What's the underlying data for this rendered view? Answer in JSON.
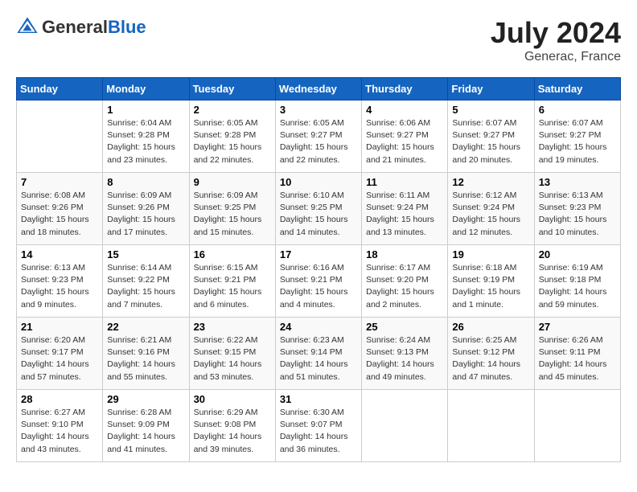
{
  "header": {
    "logo_general": "General",
    "logo_blue": "Blue",
    "month_year": "July 2024",
    "location": "Generac, France"
  },
  "weekdays": [
    "Sunday",
    "Monday",
    "Tuesday",
    "Wednesday",
    "Thursday",
    "Friday",
    "Saturday"
  ],
  "weeks": [
    [
      {
        "day": "",
        "info": ""
      },
      {
        "day": "1",
        "info": "Sunrise: 6:04 AM\nSunset: 9:28 PM\nDaylight: 15 hours\nand 23 minutes."
      },
      {
        "day": "2",
        "info": "Sunrise: 6:05 AM\nSunset: 9:28 PM\nDaylight: 15 hours\nand 22 minutes."
      },
      {
        "day": "3",
        "info": "Sunrise: 6:05 AM\nSunset: 9:27 PM\nDaylight: 15 hours\nand 22 minutes."
      },
      {
        "day": "4",
        "info": "Sunrise: 6:06 AM\nSunset: 9:27 PM\nDaylight: 15 hours\nand 21 minutes."
      },
      {
        "day": "5",
        "info": "Sunrise: 6:07 AM\nSunset: 9:27 PM\nDaylight: 15 hours\nand 20 minutes."
      },
      {
        "day": "6",
        "info": "Sunrise: 6:07 AM\nSunset: 9:27 PM\nDaylight: 15 hours\nand 19 minutes."
      }
    ],
    [
      {
        "day": "7",
        "info": "Sunrise: 6:08 AM\nSunset: 9:26 PM\nDaylight: 15 hours\nand 18 minutes."
      },
      {
        "day": "8",
        "info": "Sunrise: 6:09 AM\nSunset: 9:26 PM\nDaylight: 15 hours\nand 17 minutes."
      },
      {
        "day": "9",
        "info": "Sunrise: 6:09 AM\nSunset: 9:25 PM\nDaylight: 15 hours\nand 15 minutes."
      },
      {
        "day": "10",
        "info": "Sunrise: 6:10 AM\nSunset: 9:25 PM\nDaylight: 15 hours\nand 14 minutes."
      },
      {
        "day": "11",
        "info": "Sunrise: 6:11 AM\nSunset: 9:24 PM\nDaylight: 15 hours\nand 13 minutes."
      },
      {
        "day": "12",
        "info": "Sunrise: 6:12 AM\nSunset: 9:24 PM\nDaylight: 15 hours\nand 12 minutes."
      },
      {
        "day": "13",
        "info": "Sunrise: 6:13 AM\nSunset: 9:23 PM\nDaylight: 15 hours\nand 10 minutes."
      }
    ],
    [
      {
        "day": "14",
        "info": "Sunrise: 6:13 AM\nSunset: 9:23 PM\nDaylight: 15 hours\nand 9 minutes."
      },
      {
        "day": "15",
        "info": "Sunrise: 6:14 AM\nSunset: 9:22 PM\nDaylight: 15 hours\nand 7 minutes."
      },
      {
        "day": "16",
        "info": "Sunrise: 6:15 AM\nSunset: 9:21 PM\nDaylight: 15 hours\nand 6 minutes."
      },
      {
        "day": "17",
        "info": "Sunrise: 6:16 AM\nSunset: 9:21 PM\nDaylight: 15 hours\nand 4 minutes."
      },
      {
        "day": "18",
        "info": "Sunrise: 6:17 AM\nSunset: 9:20 PM\nDaylight: 15 hours\nand 2 minutes."
      },
      {
        "day": "19",
        "info": "Sunrise: 6:18 AM\nSunset: 9:19 PM\nDaylight: 15 hours\nand 1 minute."
      },
      {
        "day": "20",
        "info": "Sunrise: 6:19 AM\nSunset: 9:18 PM\nDaylight: 14 hours\nand 59 minutes."
      }
    ],
    [
      {
        "day": "21",
        "info": "Sunrise: 6:20 AM\nSunset: 9:17 PM\nDaylight: 14 hours\nand 57 minutes."
      },
      {
        "day": "22",
        "info": "Sunrise: 6:21 AM\nSunset: 9:16 PM\nDaylight: 14 hours\nand 55 minutes."
      },
      {
        "day": "23",
        "info": "Sunrise: 6:22 AM\nSunset: 9:15 PM\nDaylight: 14 hours\nand 53 minutes."
      },
      {
        "day": "24",
        "info": "Sunrise: 6:23 AM\nSunset: 9:14 PM\nDaylight: 14 hours\nand 51 minutes."
      },
      {
        "day": "25",
        "info": "Sunrise: 6:24 AM\nSunset: 9:13 PM\nDaylight: 14 hours\nand 49 minutes."
      },
      {
        "day": "26",
        "info": "Sunrise: 6:25 AM\nSunset: 9:12 PM\nDaylight: 14 hours\nand 47 minutes."
      },
      {
        "day": "27",
        "info": "Sunrise: 6:26 AM\nSunset: 9:11 PM\nDaylight: 14 hours\nand 45 minutes."
      }
    ],
    [
      {
        "day": "28",
        "info": "Sunrise: 6:27 AM\nSunset: 9:10 PM\nDaylight: 14 hours\nand 43 minutes."
      },
      {
        "day": "29",
        "info": "Sunrise: 6:28 AM\nSunset: 9:09 PM\nDaylight: 14 hours\nand 41 minutes."
      },
      {
        "day": "30",
        "info": "Sunrise: 6:29 AM\nSunset: 9:08 PM\nDaylight: 14 hours\nand 39 minutes."
      },
      {
        "day": "31",
        "info": "Sunrise: 6:30 AM\nSunset: 9:07 PM\nDaylight: 14 hours\nand 36 minutes."
      },
      {
        "day": "",
        "info": ""
      },
      {
        "day": "",
        "info": ""
      },
      {
        "day": "",
        "info": ""
      }
    ]
  ]
}
